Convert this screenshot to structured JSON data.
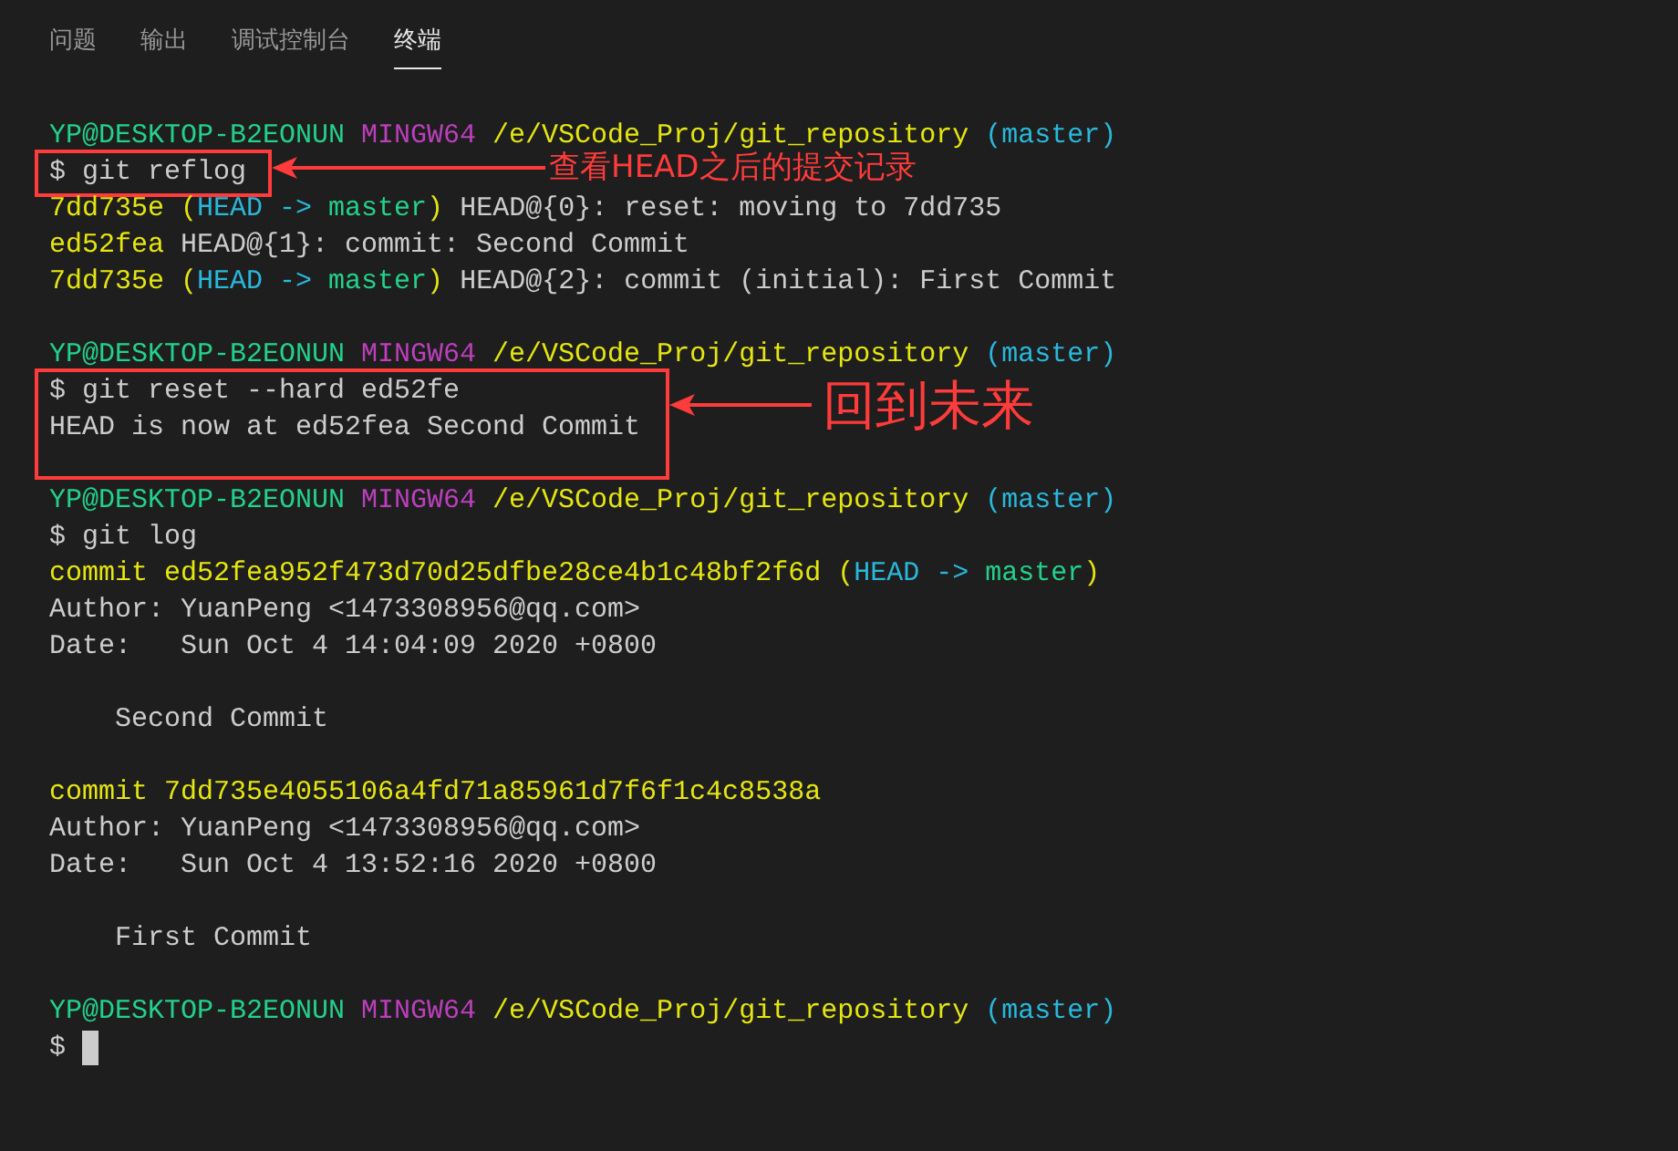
{
  "tabs": [
    {
      "label": "问题",
      "selected": false
    },
    {
      "label": "输出",
      "selected": false
    },
    {
      "label": "调试控制台",
      "selected": false
    },
    {
      "label": "终端",
      "selected": true
    }
  ],
  "terminal": {
    "paragraphs": [
      {
        "groups": [
          {
            "lines": [
              {
                "segments": [
                  {
                    "kind": "user",
                    "text": "YP@DESKTOP-B2EONUN "
                  },
                  {
                    "kind": "system",
                    "text": "MINGW64 "
                  },
                  {
                    "kind": "path",
                    "text": "/e/VSCode_Proj/git_repository "
                  },
                  {
                    "kind": "branch",
                    "text": "(master)"
                  }
                ]
              }
            ]
          },
          {
            "callout": "查看HEAD之后的提交记录",
            "lines": [
              {
                "segments": [
                  {
                    "kind": "plain",
                    "text": "$ git reflog"
                  }
                ]
              }
            ]
          },
          {
            "lines": [
              {
                "segments": [
                  {
                    "kind": "hash",
                    "text": "7dd735e ("
                  },
                  {
                    "kind": "head",
                    "text": "HEAD -> "
                  },
                  {
                    "kind": "ref",
                    "text": "master"
                  },
                  {
                    "kind": "hash",
                    "text": ") "
                  },
                  {
                    "kind": "plain",
                    "text": "HEAD@{0}: reset: moving to 7dd735"
                  }
                ]
              },
              {
                "segments": [
                  {
                    "kind": "hash",
                    "text": "ed52fea "
                  },
                  {
                    "kind": "plain",
                    "text": "HEAD@{1}: commit: Second Commit"
                  }
                ]
              },
              {
                "segments": [
                  {
                    "kind": "hash",
                    "text": "7dd735e ("
                  },
                  {
                    "kind": "head",
                    "text": "HEAD -> "
                  },
                  {
                    "kind": "ref",
                    "text": "master"
                  },
                  {
                    "kind": "hash",
                    "text": ") "
                  },
                  {
                    "kind": "plain",
                    "text": "HEAD@{2}: commit (initial): First Commit"
                  }
                ]
              }
            ]
          }
        ]
      },
      {
        "groups": [
          {
            "lines": [
              {
                "segments": [
                  {
                    "kind": "user",
                    "text": "YP@DESKTOP-B2EONUN "
                  },
                  {
                    "kind": "system",
                    "text": "MINGW64 "
                  },
                  {
                    "kind": "path",
                    "text": "/e/VSCode_Proj/git_repository "
                  },
                  {
                    "kind": "branch",
                    "text": "(master)"
                  }
                ]
              }
            ]
          },
          {
            "callout": "回到未来",
            "lines": [
              {
                "segments": [
                  {
                    "kind": "plain",
                    "text": "$ git reset --hard ed52fe"
                  }
                ]
              },
              {
                "segments": [
                  {
                    "kind": "plain",
                    "text": "HEAD is now at ed52fea Second Commit"
                  }
                ]
              }
            ]
          }
        ]
      },
      {
        "groups": [
          {
            "lines": [
              {
                "segments": [
                  {
                    "kind": "user",
                    "text": "YP@DESKTOP-B2EONUN "
                  },
                  {
                    "kind": "system",
                    "text": "MINGW64 "
                  },
                  {
                    "kind": "path",
                    "text": "/e/VSCode_Proj/git_repository "
                  },
                  {
                    "kind": "branch",
                    "text": "(master)"
                  }
                ]
              },
              {
                "segments": [
                  {
                    "kind": "plain",
                    "text": "$ git log"
                  }
                ]
              },
              {
                "segments": [
                  {
                    "kind": "hash",
                    "text": "commit ed52fea952f473d70d25dfbe28ce4b1c48bf2f6d ("
                  },
                  {
                    "kind": "head",
                    "text": "HEAD -> "
                  },
                  {
                    "kind": "ref",
                    "text": "master"
                  },
                  {
                    "kind": "hash",
                    "text": ")"
                  }
                ]
              },
              {
                "segments": [
                  {
                    "kind": "plain",
                    "text": "Author: YuanPeng <1473308956@qq.com>"
                  }
                ]
              },
              {
                "segments": [
                  {
                    "kind": "plain",
                    "text": "Date:   Sun Oct 4 14:04:09 2020 +0800"
                  }
                ]
              }
            ]
          }
        ]
      },
      {
        "groups": [
          {
            "lines": [
              {
                "segments": [
                  {
                    "kind": "plain",
                    "text": "    Second Commit"
                  }
                ]
              }
            ]
          }
        ]
      },
      {
        "groups": [
          {
            "lines": [
              {
                "segments": [
                  {
                    "kind": "hash",
                    "text": "commit 7dd735e4055106a4fd71a85961d7f6f1c4c8538a"
                  }
                ]
              },
              {
                "segments": [
                  {
                    "kind": "plain",
                    "text": "Author: YuanPeng <1473308956@qq.com>"
                  }
                ]
              },
              {
                "segments": [
                  {
                    "kind": "plain",
                    "text": "Date:   Sun Oct 4 13:52:16 2020 +0800"
                  }
                ]
              }
            ]
          }
        ]
      },
      {
        "groups": [
          {
            "lines": [
              {
                "segments": [
                  {
                    "kind": "plain",
                    "text": "    First Commit"
                  }
                ]
              }
            ]
          }
        ]
      },
      {
        "groups": [
          {
            "lines": [
              {
                "segments": [
                  {
                    "kind": "user",
                    "text": "YP@DESKTOP-B2EONUN "
                  },
                  {
                    "kind": "system",
                    "text": "MINGW64 "
                  },
                  {
                    "kind": "path",
                    "text": "/e/VSCode_Proj/git_repository "
                  },
                  {
                    "kind": "branch",
                    "text": "(master)"
                  }
                ]
              },
              {
                "segments": [
                  {
                    "kind": "plain",
                    "text": "$ "
                  }
                ],
                "cursor": true
              }
            ]
          }
        ]
      }
    ]
  }
}
